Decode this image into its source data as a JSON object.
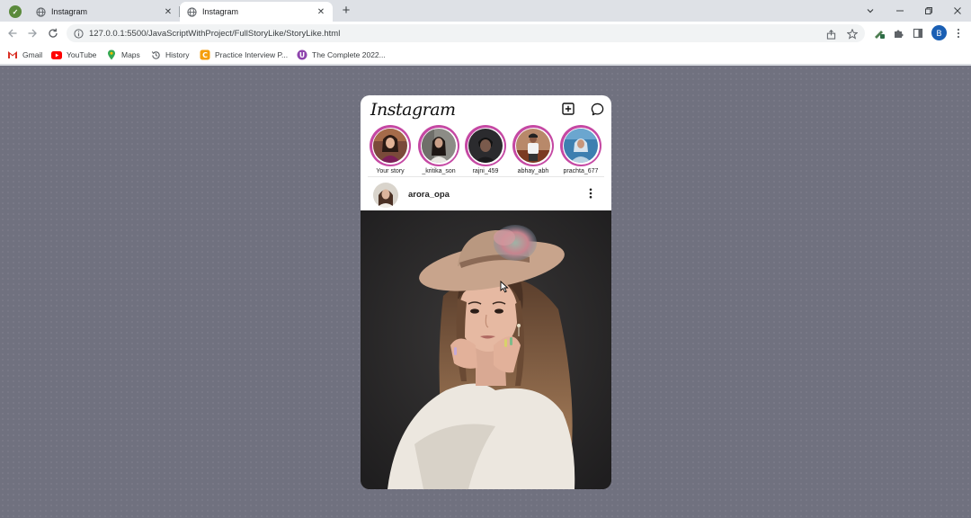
{
  "browser": {
    "tabs": [
      {
        "title": "Instagram",
        "active": false
      },
      {
        "title": "Instagram",
        "active": true
      }
    ],
    "new_tab_label": "+",
    "close_glyph": "✕",
    "url": "127.0.0.1:5500/JavaScriptWithProject/FullStoryLike/StoryLike.html",
    "profile_initial": "B",
    "bookmarks": [
      {
        "label": "Gmail",
        "icon": "gmail-icon"
      },
      {
        "label": "YouTube",
        "icon": "youtube-icon"
      },
      {
        "label": "Maps",
        "icon": "maps-icon"
      },
      {
        "label": "History",
        "icon": "history-icon"
      },
      {
        "label": "Practice Interview P...",
        "icon": "practice-icon"
      },
      {
        "label": "The Complete 2022...",
        "icon": "course-icon"
      }
    ]
  },
  "app": {
    "logo": "Instagram",
    "stories": [
      {
        "name": "Your story"
      },
      {
        "name": "_kritika_son"
      },
      {
        "name": "rajni_459"
      },
      {
        "name": "abhay_abh"
      },
      {
        "name": "prachta_677"
      }
    ],
    "post": {
      "username": "arora_opa"
    }
  },
  "colors": {
    "page_background": "#70717f",
    "story_ring": "#c548a3",
    "tab_strip": "#dee1e6",
    "profile_badge": "#1a5fb4"
  }
}
